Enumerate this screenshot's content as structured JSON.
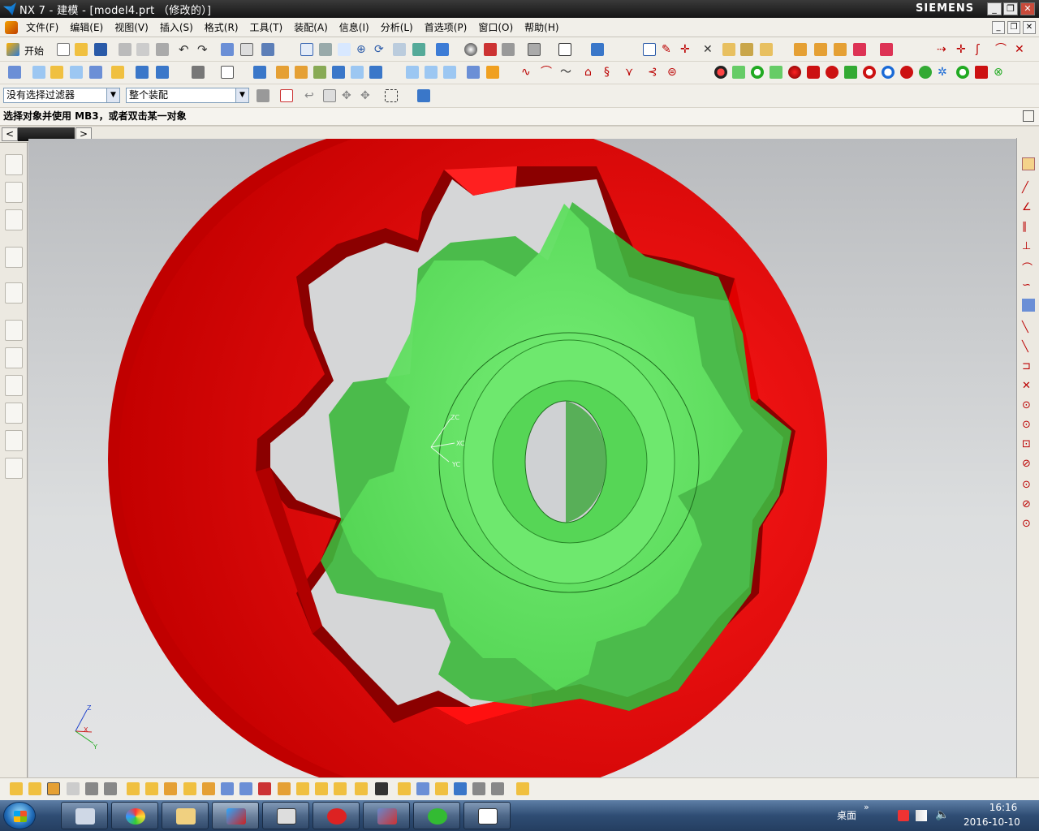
{
  "window": {
    "title": "NX 7 - 建模 - [model4.prt （修改的）]",
    "brand": "SIEMENS",
    "controls": [
      "_",
      "❐",
      "✕"
    ]
  },
  "menu": {
    "items": [
      "文件(F)",
      "编辑(E)",
      "视图(V)",
      "插入(S)",
      "格式(R)",
      "工具(T)",
      "装配(A)",
      "信息(I)",
      "分析(L)",
      "首选项(P)",
      "窗口(O)",
      "帮助(H)"
    ]
  },
  "toolbar": {
    "start_label": "开始",
    "filter_value": "没有选择过滤器",
    "scope_value": "整个装配"
  },
  "cue_line": "选择对象并使用 MB3，或者双击某一对象",
  "tab_strip": {
    "left_arrow": "<",
    "right_arrow": ">"
  },
  "viewport": {
    "background": "#cfd1d3",
    "outer_body_color": "#ff0000",
    "gear_color": "#5fe65f",
    "wcs_labels": {
      "x": "XC",
      "y": "YC",
      "z": "ZC"
    },
    "abs_axes": {
      "x": "X",
      "y": "Y",
      "z": "Z"
    }
  },
  "taskbar": {
    "desktop_label": "桌面",
    "time": "16:16",
    "date": "2016-10-10",
    "chevron": "»"
  }
}
